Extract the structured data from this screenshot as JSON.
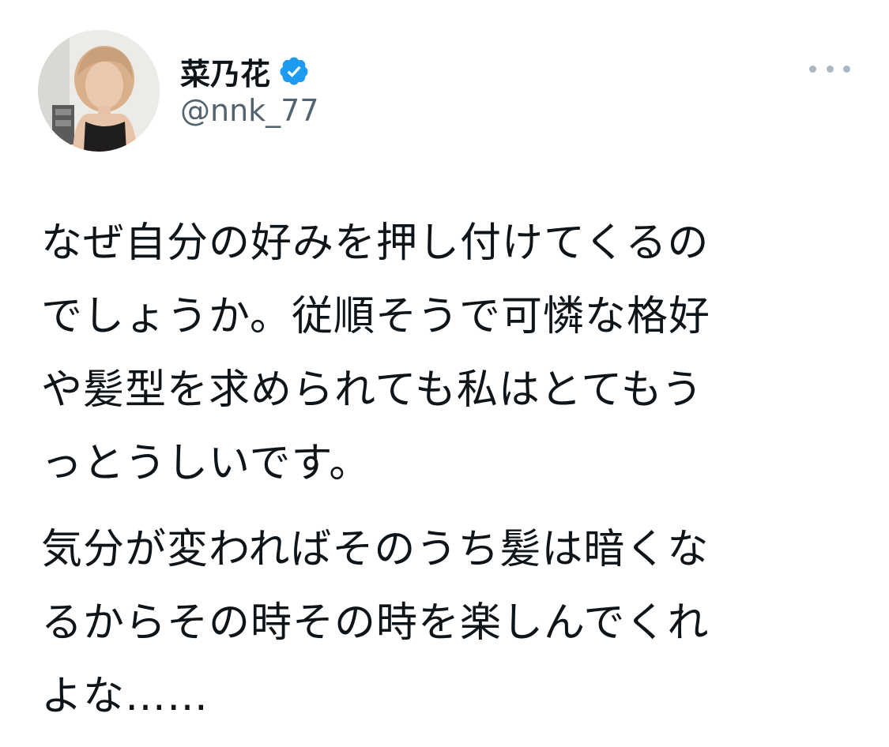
{
  "user": {
    "display_name": "菜乃花",
    "handle": "@nnk_77",
    "verified": true,
    "verified_color": "#1d9bf0",
    "avatar_icon": "profile-photo"
  },
  "menu": {
    "icon": "more-options-icon"
  },
  "tweet": {
    "paragraphs": [
      {
        "lines": [
          "なぜ自分の好みを押し付けてくるの",
          "でしょうか。従順そうで可憐な格好",
          "や髪型を求められても私はとてもう",
          "っとうしいです。"
        ]
      },
      {
        "lines": [
          "気分が変わればそのうち髪は暗くな",
          "るからその時その時を楽しんでくれ",
          "よな……"
        ]
      }
    ]
  }
}
